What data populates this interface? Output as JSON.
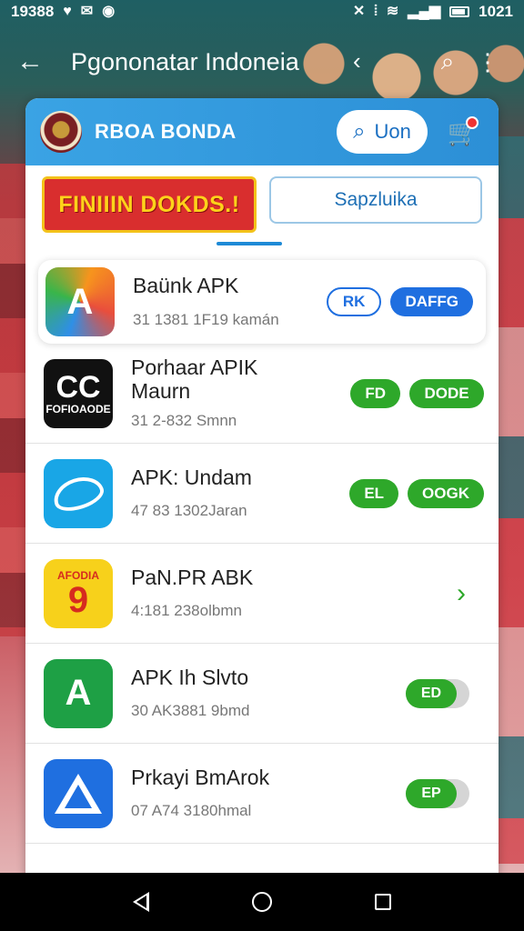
{
  "status_bar": {
    "time": "19388",
    "clock": "1021"
  },
  "app_bar": {
    "title": "Pgononatar Indoneia"
  },
  "card": {
    "brand_name": "RBOA BONDA",
    "search_label": "Uon",
    "banner_text": "FINIIIN DOKDS.!",
    "secondary_button": "Sapzluika"
  },
  "apps": [
    {
      "name": "Baünk APK",
      "meta": "31 1381 1F19 kamán",
      "actions": [
        "RK",
        "DAFFG"
      ]
    },
    {
      "name": "Porhaar APIK\nMaurn",
      "meta": "31 2-832 Smnn",
      "actions": [
        "FD",
        "DODE"
      ],
      "icon_text": "FOFIOAODE",
      "icon_glyph": "CC"
    },
    {
      "name": "APK: Undam",
      "meta": "47 83 1302Jaran",
      "actions": [
        "EL",
        "OOGK"
      ]
    },
    {
      "name": "PaN.PR ABK",
      "meta": "4:181 238olbmn",
      "icon_text": "AFODIA",
      "icon_glyph": "9"
    },
    {
      "name": "APK Ih Slvto",
      "meta": "30 AK3881 9bmd",
      "toggle": "ED",
      "icon_glyph": "A"
    },
    {
      "name": "Prkayi BmArok",
      "meta": "07 A74 3180hmal",
      "toggle": "EP"
    }
  ],
  "colors": {
    "header_blue": "#2c8fd6",
    "accent_green": "#2ea82a",
    "accent_blue": "#1f6fe0"
  }
}
